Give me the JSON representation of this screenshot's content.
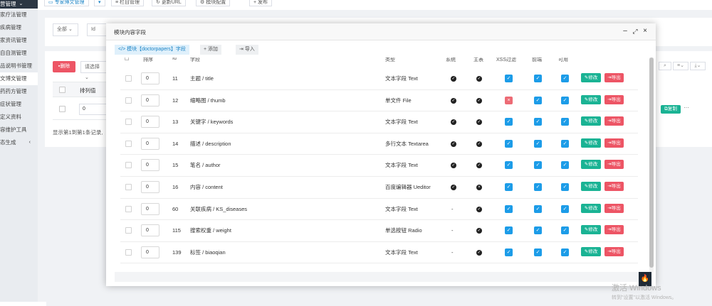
{
  "sidebar": {
    "top_label": "营管理",
    "items": [
      {
        "label": "家疗法管理"
      },
      {
        "label": "疾病管理"
      },
      {
        "label": "家资讯管理"
      },
      {
        "label": "自自测管理"
      },
      {
        "label": "品说明书管理"
      },
      {
        "label": "文博文管理"
      },
      {
        "label": "药药方管理"
      },
      {
        "label": "症状管理"
      },
      {
        "label": "定义资料"
      },
      {
        "label": "容维护工具"
      },
      {
        "label": "态生成"
      }
    ]
  },
  "topbar": {
    "buttons": [
      "专家博文管理",
      "",
      "栏目管理",
      "更新URL",
      "模块配置",
      "发布"
    ]
  },
  "background": {
    "filter_all": "全部",
    "filter_id": "Id",
    "delete_label": "删除",
    "select_placeholder": "请选择",
    "col_sort": "排列值",
    "row_sort_value": "0",
    "info_text": "显示第1到第1条记录,",
    "copy_label": "复制",
    "more_label": "···"
  },
  "modal": {
    "title": "模块内容字段",
    "module_tag": "模块【doctorpapers】字段",
    "add_label": "添加",
    "import_label": "导入",
    "headers": [
      "排序",
      "Id",
      "字段",
      "类型",
      "系统",
      "主表",
      "XSS过滤",
      "前端",
      "可用"
    ],
    "edit_label": "修改",
    "export_label": "导出",
    "rows": [
      {
        "order": "0",
        "id": "11",
        "field": "主题 / title",
        "type": "文本字段 Text",
        "system": "dot",
        "main": "dot",
        "xss": "on",
        "front": "on",
        "enabled": "on"
      },
      {
        "order": "0",
        "id": "12",
        "field": "缩略图 / thumb",
        "type": "单文件 File",
        "system": "dot",
        "main": "dot",
        "xss": "off",
        "front": "on",
        "enabled": "on"
      },
      {
        "order": "0",
        "id": "13",
        "field": "关键字 / keywords",
        "type": "文本字段 Text",
        "system": "dot",
        "main": "dot",
        "xss": "on",
        "front": "on",
        "enabled": "on"
      },
      {
        "order": "0",
        "id": "14",
        "field": "描述 / description",
        "type": "多行文本 Textarea",
        "system": "dot",
        "main": "dot",
        "xss": "on",
        "front": "on",
        "enabled": "on"
      },
      {
        "order": "0",
        "id": "15",
        "field": "笔名 / author",
        "type": "文本字段 Text",
        "system": "dot",
        "main": "dot",
        "xss": "on",
        "front": "on",
        "enabled": "on"
      },
      {
        "order": "0",
        "id": "16",
        "field": "内容 / content",
        "type": "百度编辑器 Ueditor",
        "system": "dot",
        "main": "x",
        "xss": "on",
        "front": "on",
        "enabled": "on"
      },
      {
        "order": "0",
        "id": "60",
        "field": "关联疾病 / KS_diseases",
        "type": "文本字段 Text",
        "system": "-",
        "main": "dot",
        "xss": "on",
        "front": "on",
        "enabled": "on"
      },
      {
        "order": "0",
        "id": "115",
        "field": "搜索权重 / weight",
        "type": "单选按钮 Radio",
        "system": "-",
        "main": "dot",
        "xss": "on",
        "front": "on",
        "enabled": "on"
      },
      {
        "order": "0",
        "id": "139",
        "field": "标签 / biaoqian",
        "type": "文本字段 Text",
        "system": "-",
        "main": "dot",
        "xss": "on",
        "front": "on",
        "enabled": "on"
      }
    ]
  },
  "watermark": {
    "line1": "激活 Windows",
    "line2": "转到\"设置\"以激活 Windows。"
  },
  "colors": {
    "primary": "#1c84c6",
    "success": "#1ab394",
    "danger": "#ed5565",
    "checked": "#1c9ce8",
    "sidebar_dark": "#2b3643"
  }
}
